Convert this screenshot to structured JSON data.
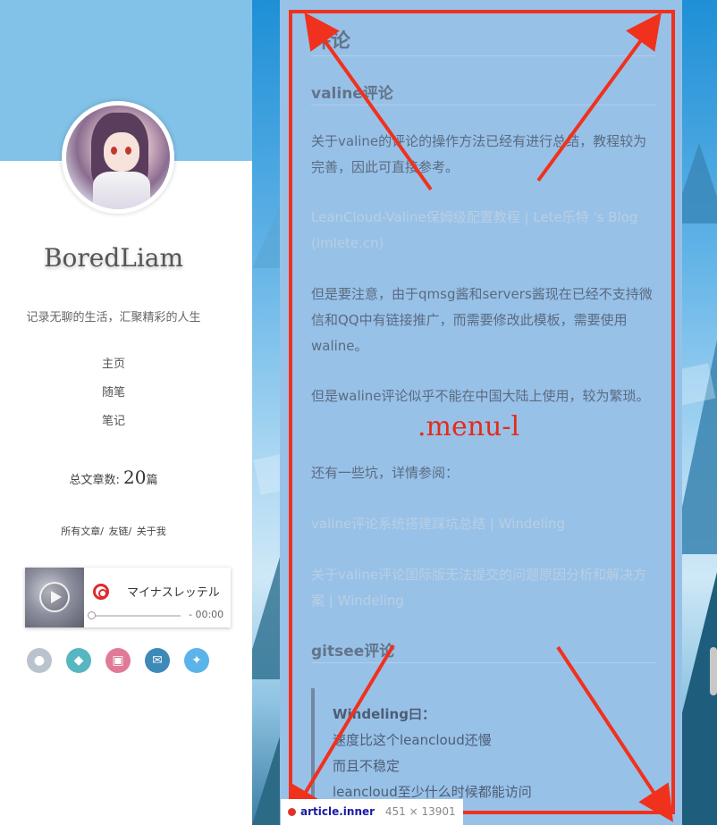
{
  "sidebar": {
    "site_name": "BoredLiam",
    "tagline": "记录无聊的生活，汇聚精彩的人生",
    "nav": [
      "主页",
      "随笔",
      "笔记"
    ],
    "post_count_label": "总文章数:",
    "post_count_value": "20",
    "post_count_unit": "篇",
    "links": [
      "所有文章/",
      "友链/",
      "关于我"
    ]
  },
  "player": {
    "title": "マイナスレッテル",
    "time": "- 00:00"
  },
  "social_icons": [
    {
      "name": "github-icon",
      "color": "#b9c3cd"
    },
    {
      "name": "qq-icon",
      "color": "#56b6c2"
    },
    {
      "name": "bilibili-icon",
      "color": "#e07a97"
    },
    {
      "name": "email-icon",
      "color": "#3d8ab8"
    },
    {
      "name": "twitter-icon",
      "color": "#5ab4ea"
    }
  ],
  "article": {
    "heading": "评论",
    "section1_title": "valine评论",
    "p1": "关于valine的评论的操作方法已经有进行总结，教程较为完善，因此可直接参考。",
    "link1": "LeanCloud-Valine保姆级配置教程 | Lete乐特 's Blog (imlete.cn)",
    "p2": "但是要注意，由于qmsg酱和servers酱现在已经不支持微信和QQ中有链接推广，而需要修改此模板，需要使用waline。",
    "p3": "但是waline评论似乎不能在中国大陆上使用，较为繁琐。",
    "p4": "还有一些坑，详情参阅：",
    "link2": "valine评论系统搭建踩坑总结 | Windeling",
    "link3": "关于valine评论国际版无法提交的问题原因分析和解决方案 | Windeling",
    "section2_title": "gitsee评论",
    "quote_lines": [
      "Windeling曰：",
      "速度比这个leancloud还慢",
      "而且不稳定",
      "leancloud至少什么时候都能访问"
    ]
  },
  "annotation": {
    "menu_label": ".menu-l",
    "accent_color": "#f0311d"
  },
  "devtools_tooltip": {
    "selector": "article.inner",
    "size": "451 × 13901"
  }
}
